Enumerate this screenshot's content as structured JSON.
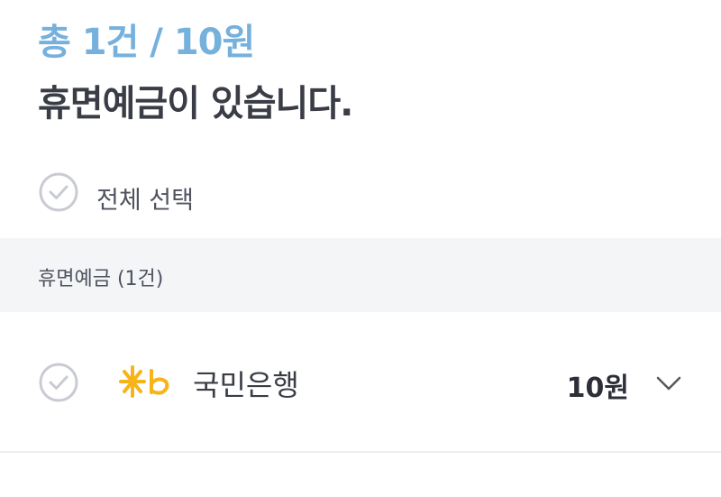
{
  "summary": {
    "total": "총 1건 / 10원",
    "headline": "휴면예금이 있습니다."
  },
  "select_all": {
    "label": "전체 선택"
  },
  "section": {
    "label": "휴면예금 (1건)"
  },
  "accounts": [
    {
      "bank_name": "국민은행",
      "amount": "10원",
      "logo_icon": "kb-bank-logo-icon",
      "expand_icon": "chevron-down-icon"
    }
  ],
  "colors": {
    "accent": "#76b1dd",
    "text_primary": "#3a3d46",
    "section_bg": "#f4f5f7",
    "check_gray": "#c9cbd3",
    "kb_yellow": "#f6b41a"
  }
}
